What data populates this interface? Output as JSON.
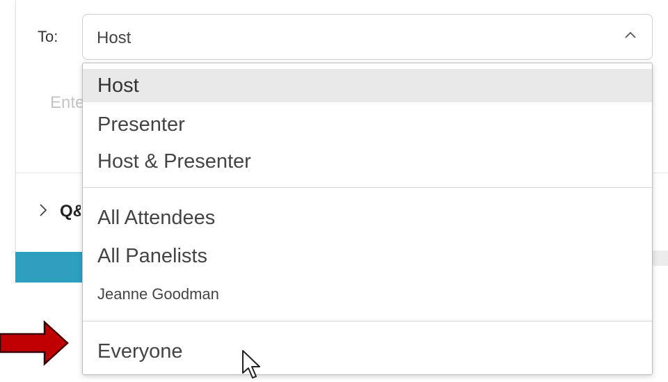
{
  "chat": {
    "to_label": "To:",
    "selected_recipient": "Host",
    "message_placeholder": "Enter chat message here",
    "qa_section_label": "Q&A"
  },
  "dropdown": {
    "options": [
      {
        "label": "Host",
        "selected": true
      },
      {
        "label": "Presenter"
      },
      {
        "label": "Host & Presenter"
      },
      {
        "label": "All Attendees"
      },
      {
        "label": "All Panelists"
      },
      {
        "label": "Jeanne Goodman"
      },
      {
        "label": "Everyone"
      }
    ]
  },
  "colors": {
    "arrow": "#c00000",
    "teal_accent": "#2f9fbf",
    "selected_row": "#e9e9ea"
  },
  "icons": [
    "chevron-up-icon",
    "chevron-right-icon",
    "red-arrow-icon",
    "mouse-pointer-icon"
  ]
}
